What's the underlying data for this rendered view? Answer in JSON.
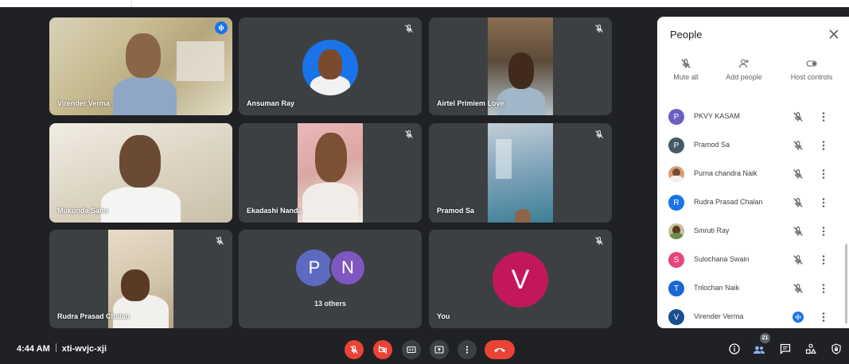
{
  "tiles": [
    {
      "name": "Virender Verma"
    },
    {
      "name": "Ansuman Ray"
    },
    {
      "name": "Airtel Primiem Love"
    },
    {
      "name": "Mukunda Sahu"
    },
    {
      "name": "Ekadashi Nanda"
    },
    {
      "name": "Pramod Sa"
    },
    {
      "name": "Rudra Prasad Chalan"
    },
    {
      "name": "13 others",
      "avatars": [
        "P",
        "N"
      ]
    },
    {
      "name": "You",
      "avatar": "V"
    }
  ],
  "meeting": {
    "time": "4:44 AM",
    "code": "xti-wvjc-xji"
  },
  "controls": {
    "mic_icon": "mic-off-icon",
    "camera_icon": "camera-off-icon",
    "captions_icon": "captions-icon",
    "present_icon": "present-icon",
    "more_icon": "more-vert-icon",
    "leave_icon": "call-end-icon"
  },
  "right_controls": {
    "people_count": "21"
  },
  "people_panel": {
    "title": "People",
    "actions": {
      "mute_all": "Mute all",
      "add_people": "Add people",
      "host_controls": "Host controls"
    },
    "participants": [
      {
        "initial": "P",
        "name": "PKVY KASAM",
        "color": "#6a5fc1"
      },
      {
        "initial": "P",
        "name": "Pramod Sa",
        "color": "#455a64"
      },
      {
        "initial": "",
        "name": "Purna chandra Naik",
        "color": "#d7a07d"
      },
      {
        "initial": "R",
        "name": "Rudra Prasad Chalan",
        "color": "#1a73e8"
      },
      {
        "initial": "",
        "name": "Smruti Ray",
        "color": "#8a9a5b"
      },
      {
        "initial": "S",
        "name": "Sulochana Swain",
        "color": "#e8457c"
      },
      {
        "initial": "T",
        "name": "Trilochan Naik",
        "color": "#1967d2"
      },
      {
        "initial": "V",
        "name": "Virender Verma",
        "color": "#1a4f8f"
      }
    ]
  },
  "colors": {
    "accent": "#8ab4f8",
    "end_call": "#ea4335",
    "you_avatar": "#c2185b"
  }
}
